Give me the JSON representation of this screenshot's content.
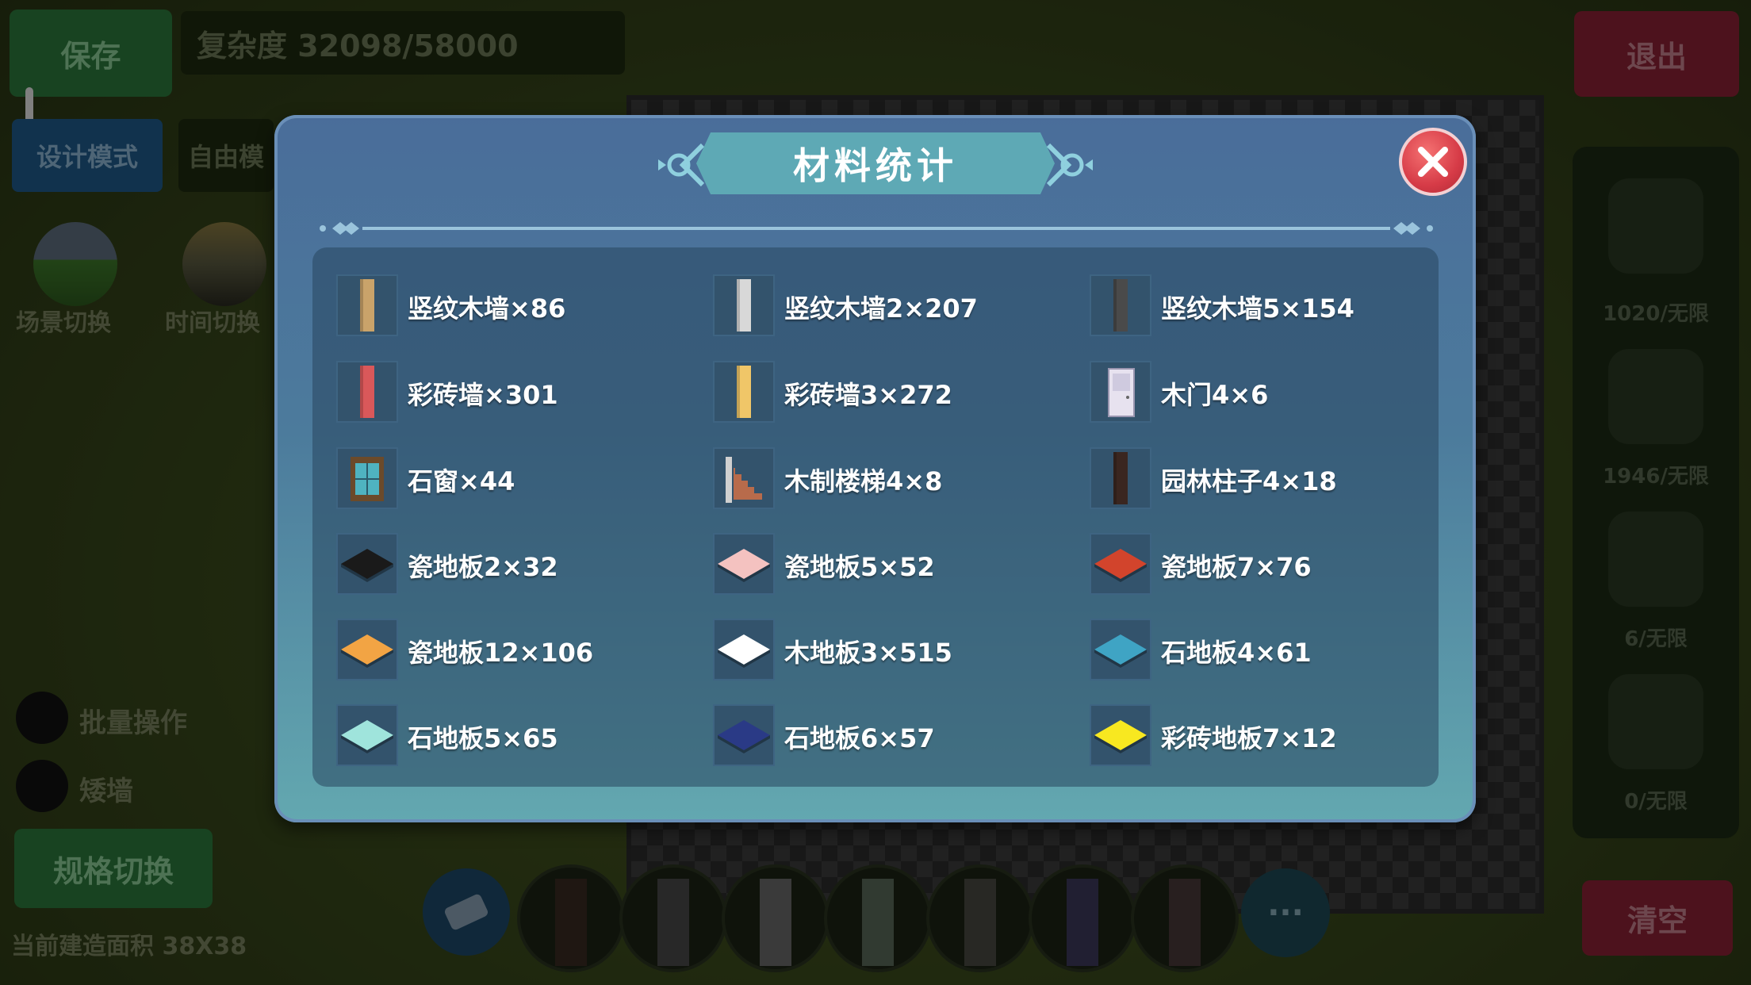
{
  "background": {
    "save_label": "保存",
    "complexity_text": "复杂度 32098/58000",
    "exit_label": "退出",
    "design_mode_label": "设计模式",
    "free_mode_label": "自由模",
    "scene_switch_label": "场景切换",
    "time_switch_label": "时间切换",
    "batch_op_label": "批量操作",
    "low_wall_label": "矮墙",
    "spec_switch_label": "规格切换",
    "build_area_text": "当前建造面积 38X38",
    "clear_label": "清空",
    "right_counts": [
      "1020/无限",
      "1946/无限",
      "6/无限",
      "0/无限"
    ],
    "more_label": "···"
  },
  "modal": {
    "title": "材料统计",
    "items": [
      {
        "label": "竖纹木墙×86",
        "icon": "wood-wall-icon",
        "color": "#c9a36a"
      },
      {
        "label": "竖纹木墙2×207",
        "icon": "wood-wall-2-icon",
        "color": "#d8d8d8"
      },
      {
        "label": "竖纹木墙5×154",
        "icon": "wood-wall-5-icon",
        "color": "#4a4a4a"
      },
      {
        "label": "彩砖墙×301",
        "icon": "color-brick-wall-icon",
        "color": "#d9585a"
      },
      {
        "label": "彩砖墙3×272",
        "icon": "color-brick-wall-3-icon",
        "color": "#f0c668"
      },
      {
        "label": "木门4×6",
        "icon": "wood-door-icon",
        "color": "#e7e2ef"
      },
      {
        "label": "石窗×44",
        "icon": "stone-window-icon",
        "color": "#4fb3c0"
      },
      {
        "label": "木制楼梯4×8",
        "icon": "wood-stairs-icon",
        "color": "#b86b4b"
      },
      {
        "label": "园林柱子4×18",
        "icon": "garden-pillar-icon",
        "color": "#3a2620"
      },
      {
        "label": "瓷地板2×32",
        "icon": "tile-floor-2-icon",
        "color": "#1a1a1a"
      },
      {
        "label": "瓷地板5×52",
        "icon": "tile-floor-5-icon",
        "color": "#f4c2c0"
      },
      {
        "label": "瓷地板7×76",
        "icon": "tile-floor-7-icon",
        "color": "#d2442c"
      },
      {
        "label": "瓷地板12×106",
        "icon": "tile-floor-12-icon",
        "color": "#f2a444"
      },
      {
        "label": "木地板3×515",
        "icon": "wood-floor-3-icon",
        "color": "#ffffff"
      },
      {
        "label": "石地板4×61",
        "icon": "stone-floor-4-icon",
        "color": "#3fa4c4"
      },
      {
        "label": "石地板5×65",
        "icon": "stone-floor-5-icon",
        "color": "#9fe4dc"
      },
      {
        "label": "石地板6×57",
        "icon": "stone-floor-6-icon",
        "color": "#2a3a86"
      },
      {
        "label": "彩砖地板7×12",
        "icon": "color-brick-floor-icon",
        "color": "#f8e820"
      }
    ]
  }
}
